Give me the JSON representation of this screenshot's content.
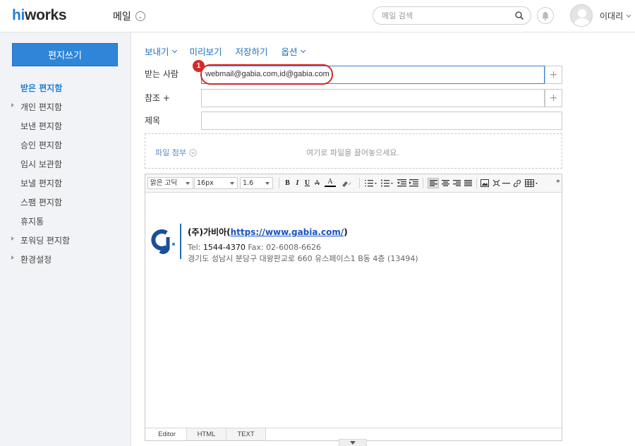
{
  "header": {
    "logo_hi": "hi",
    "logo_rest": "works",
    "app_menu": "메일",
    "search_placeholder": "메일 검색",
    "user_name": "이대리"
  },
  "sidebar": {
    "compose_label": "편지쓰기",
    "folders": [
      {
        "label": "받은 편지함",
        "active": true,
        "expandable": false
      },
      {
        "label": "개인 편지함",
        "active": false,
        "expandable": true
      },
      {
        "label": "보낸 편지함",
        "active": false,
        "expandable": false
      },
      {
        "label": "승인 편지함",
        "active": false,
        "expandable": false
      },
      {
        "label": "임시 보관함",
        "active": false,
        "expandable": false
      },
      {
        "label": "보낼 편지함",
        "active": false,
        "expandable": false
      },
      {
        "label": "스팸 편지함",
        "active": false,
        "expandable": false
      },
      {
        "label": "휴지통",
        "active": false,
        "expandable": false
      },
      {
        "label": "포워딩 편지함",
        "active": false,
        "expandable": true
      },
      {
        "label": "환경설정",
        "active": false,
        "expandable": true
      }
    ]
  },
  "compose": {
    "actions": {
      "send": "보내기",
      "preview": "미리보기",
      "save": "저장하기",
      "options": "옵션"
    },
    "to_label": "받는 사람",
    "to_value": "webmail@gabia.com,id@gabia.com",
    "cc_label": "참조 +",
    "subject_label": "제목",
    "plus": "+",
    "annotation_number": "1",
    "attach_label": "파일 첨부",
    "attach_hint": "여기로 파일을 끌어놓으세요."
  },
  "editor": {
    "font_family": "맑은 고딕",
    "font_size": "16px",
    "line_height": "1.6",
    "tabs": [
      "Editor",
      "HTML",
      "TEXT"
    ],
    "active_tab": "Editor",
    "more": "»"
  },
  "signature": {
    "company": "(주)가비아(",
    "url": "https://www.gabia.com/",
    "company_close": ")",
    "tel_label": "Tel: ",
    "tel_value": "1544-4370",
    "fax": " Fax: 02-6008-6626",
    "address": "경기도 성남시 분당구 대왕판교로 660 유스페이스1 B동 4층 (13494)"
  },
  "colors": {
    "brand_blue": "#2f86d9",
    "annotation_red": "#d32a2a",
    "link_blue": "#1f6fc0"
  }
}
